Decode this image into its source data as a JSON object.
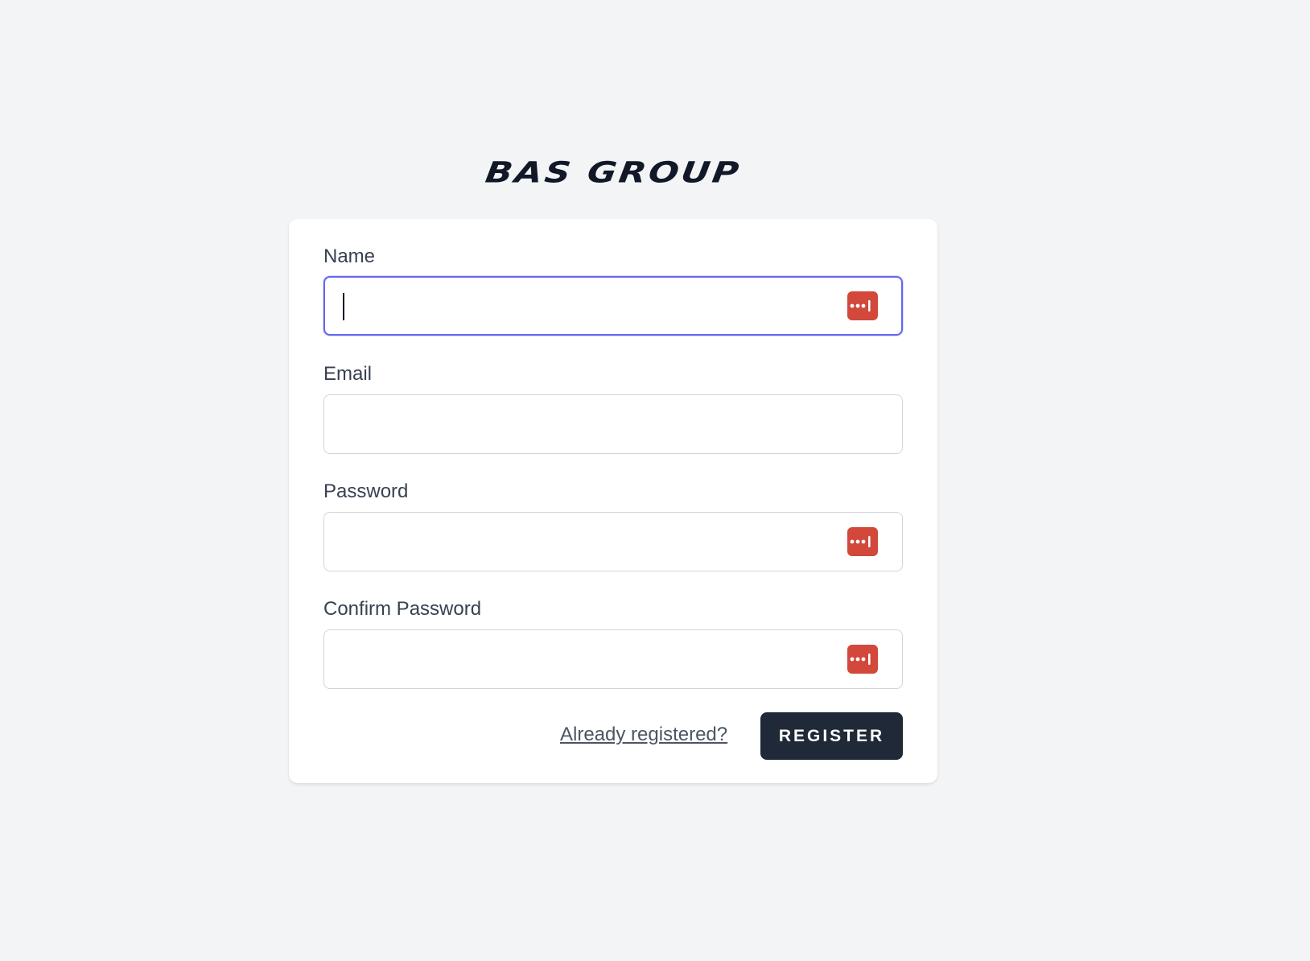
{
  "brand": {
    "logo_text": "BAS GROUP"
  },
  "form": {
    "fields": [
      {
        "label": "Name",
        "value": "",
        "icon": "password-manager-icon",
        "focused": true
      },
      {
        "label": "Email",
        "value": ""
      },
      {
        "label": "Password",
        "value": "",
        "icon": "password-manager-icon"
      },
      {
        "label": "Confirm Password",
        "value": "",
        "icon": "password-manager-icon"
      }
    ],
    "login_link": "Already registered?",
    "submit_label": "REGISTER"
  },
  "colors": {
    "background": "#f3f4f6",
    "card": "#ffffff",
    "focus_ring": "#6366f1",
    "button": "#1f2937",
    "password_manager_icon": "#d2483b"
  }
}
